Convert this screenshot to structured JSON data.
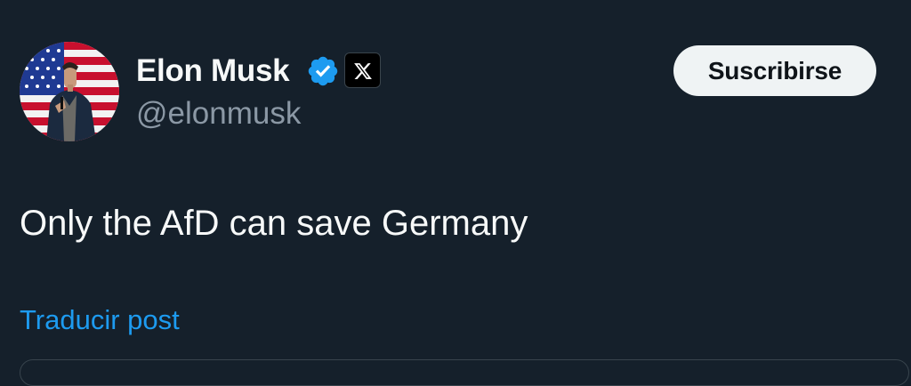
{
  "author": {
    "display_name": "Elon Musk",
    "handle": "@elonmusk",
    "verified_icon": "verified-badge-icon",
    "affiliate_icon": "x-logo-icon",
    "avatar": "profile-photo-with-american-flag"
  },
  "actions": {
    "subscribe_label": "Suscribirse"
  },
  "post": {
    "text": "Only the AfD can save Germany",
    "translate_label": "Traducir post"
  },
  "colors": {
    "background": "#15202b",
    "primary_text": "#f7f9f9",
    "secondary_text": "#8b98a5",
    "accent": "#1d9bf0",
    "button_bg": "#eff3f4",
    "button_text": "#0f1419"
  }
}
